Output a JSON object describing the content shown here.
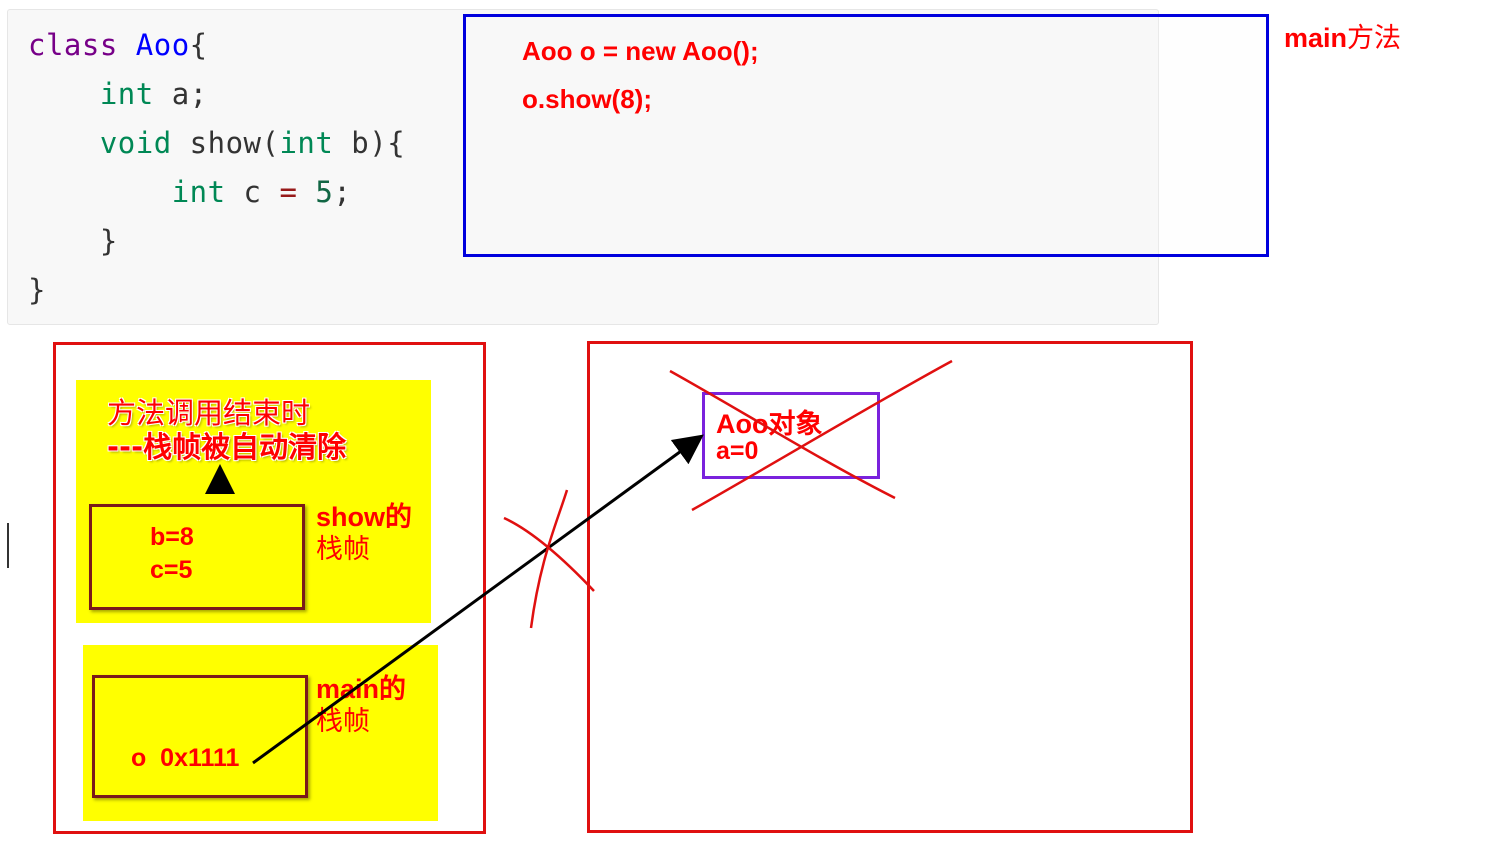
{
  "code": {
    "line1": {
      "kw": "class",
      "name": "Aoo",
      "brace": "{"
    },
    "line2": {
      "type": "int",
      "rest": " a;"
    },
    "line3": {
      "kw": "void",
      "mid": " show(",
      "type": "int",
      "rest": " b){"
    },
    "line4": {
      "type": "int",
      "var": " c ",
      "op": "=",
      "num": " 5",
      "semi": ";"
    },
    "line5": "}",
    "line6": "}"
  },
  "main_box": {
    "line1": "Aoo o = new Aoo();",
    "line2": "o.show(8);",
    "label_latin": "main",
    "label_zh": "方法"
  },
  "stack": {
    "note_line1": "方法调用结束时",
    "note_line2": "---栈帧被自动清除",
    "show_frame": {
      "line1": "b=8",
      "line2": "c=5",
      "label1": "show的",
      "label2": "栈帧"
    },
    "main_frame": {
      "value": "o  0x1111",
      "label1": "main的",
      "label2": "栈帧"
    }
  },
  "heap": {
    "object_line1": "Aoo对象",
    "object_line2": "a=0"
  },
  "colors": {
    "annotation_red": "#ff0000",
    "box_blue": "#0000dd",
    "frame_border": "#7a1a1a",
    "yellow": "#ffff00",
    "object_border": "#7a22dd",
    "arrow": "#000000"
  }
}
